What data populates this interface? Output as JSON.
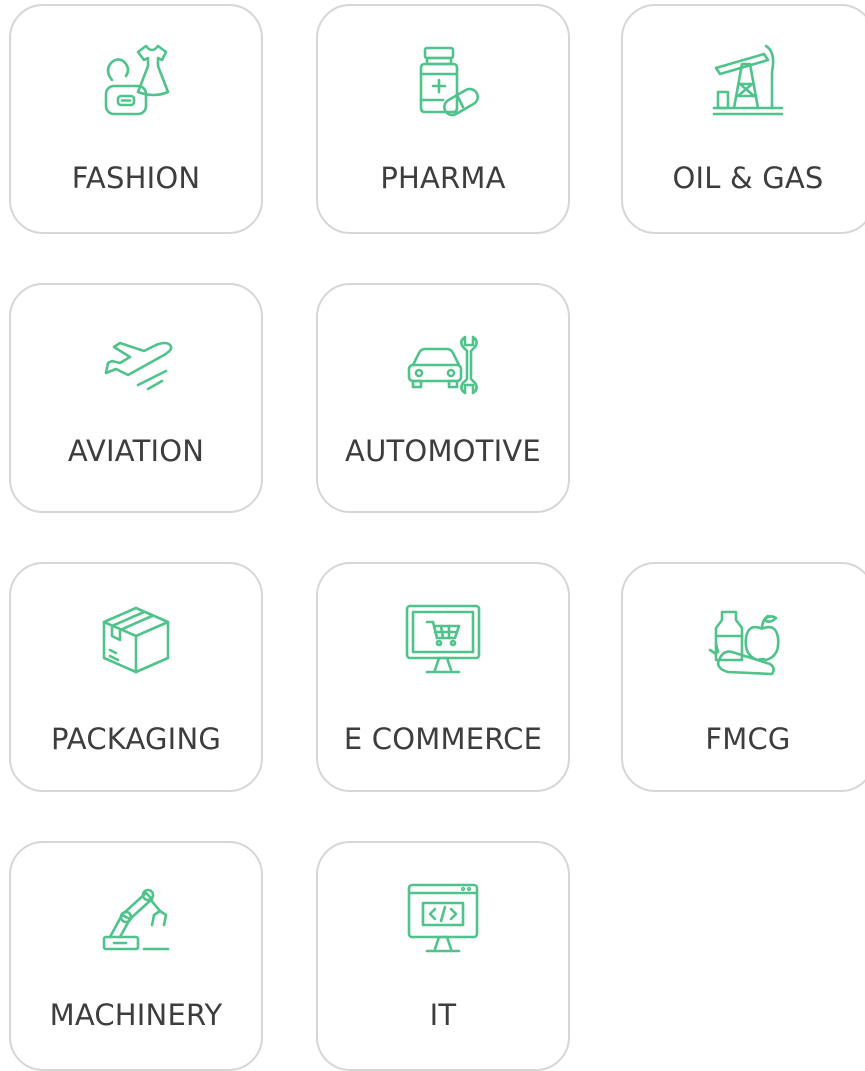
{
  "accent_color": "#4fc38b",
  "industries": [
    {
      "label": "FASHION",
      "icon": "fashion-icon"
    },
    {
      "label": "PHARMA",
      "icon": "pharma-icon"
    },
    {
      "label": "OIL & GAS",
      "icon": "oil-gas-icon"
    },
    {
      "label": "AVIATION",
      "icon": "aviation-icon"
    },
    {
      "label": "AUTOMOTIVE",
      "icon": "automotive-icon"
    },
    {
      "label": "PACKAGING",
      "icon": "packaging-icon"
    },
    {
      "label": "E COMMERCE",
      "icon": "ecommerce-icon"
    },
    {
      "label": "FMCG",
      "icon": "fmcg-icon"
    },
    {
      "label": "MACHINERY",
      "icon": "machinery-icon"
    },
    {
      "label": "IT",
      "icon": "it-icon"
    }
  ]
}
